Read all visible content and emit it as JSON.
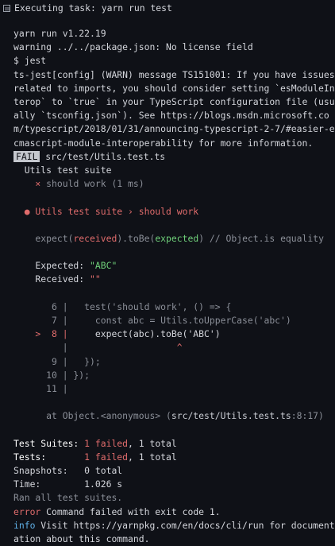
{
  "header": {
    "title": "Executing task: yarn run test"
  },
  "lines": {
    "l1": "yarn run v1.22.19",
    "l2": "warning ../../package.json: No license field",
    "l3": "$ jest",
    "l4": "ts-jest[config] (WARN) message TS151001: If you have issues related to imports, you should consider setting `esModuleInterop` to `true` in your TypeScript configuration file (usually `tsconfig.json`). See https://blogs.msdn.microsoft.com/typescript/2018/01/31/announcing-typescript-2-7/#easier-ecmascript-module-interoperability for more information.",
    "fail_badge": "FAIL",
    "fail_path": " src/test/Utils.test.ts",
    "suite": "  Utils test suite",
    "test_mark": "    ×",
    "test_name": " should work (1 ms)",
    "bullet": "  ● Utils test suite › should work",
    "expect_a": "    expect(",
    "expect_received": "received",
    "expect_b": ").toBe(",
    "expect_expected": "expected",
    "expect_c": ") // Object.is equality",
    "expected_label": "    Expected: ",
    "expected_value": "\"ABC\"",
    "received_label": "    Received: ",
    "received_value": "\"\"",
    "code6": "       6 |   test('should work', () => {",
    "code7": "       7 |     const abc = Utils.toUpperCase('abc')",
    "code8_marker": "    >  8 |",
    "code8_text": "     expect(abc).toBe('ABC')",
    "code_blank_pipe": "         |",
    "code_caret": "                    ^",
    "code9": "       9 |   });",
    "code10": "      10 | });",
    "code11": "      11 |",
    "at_a": "      at Object.<anonymous> (",
    "at_path": "src/test/Utils.test.ts",
    "at_b": ":8:17)",
    "s_suites_label": "Test Suites: ",
    "s_suites_failed": "1 failed",
    "s_suites_total": ", 1 total",
    "s_tests_label": "Tests:       ",
    "s_tests_failed": "1 failed",
    "s_tests_total": ", 1 total",
    "s_snap": "Snapshots:   0 total",
    "s_time": "Time:        1.026 s",
    "s_ran": "Ran all test suites.",
    "error_a": "error",
    "error_b": " Command failed with exit code 1.",
    "info_a": "info",
    "info_b": " Visit https://yarnpkg.com/en/docs/cli/run for documentation about this command."
  },
  "colors": {
    "fail": "#e06c6c",
    "pass": "#6fd07a",
    "background": "#0f1117"
  }
}
